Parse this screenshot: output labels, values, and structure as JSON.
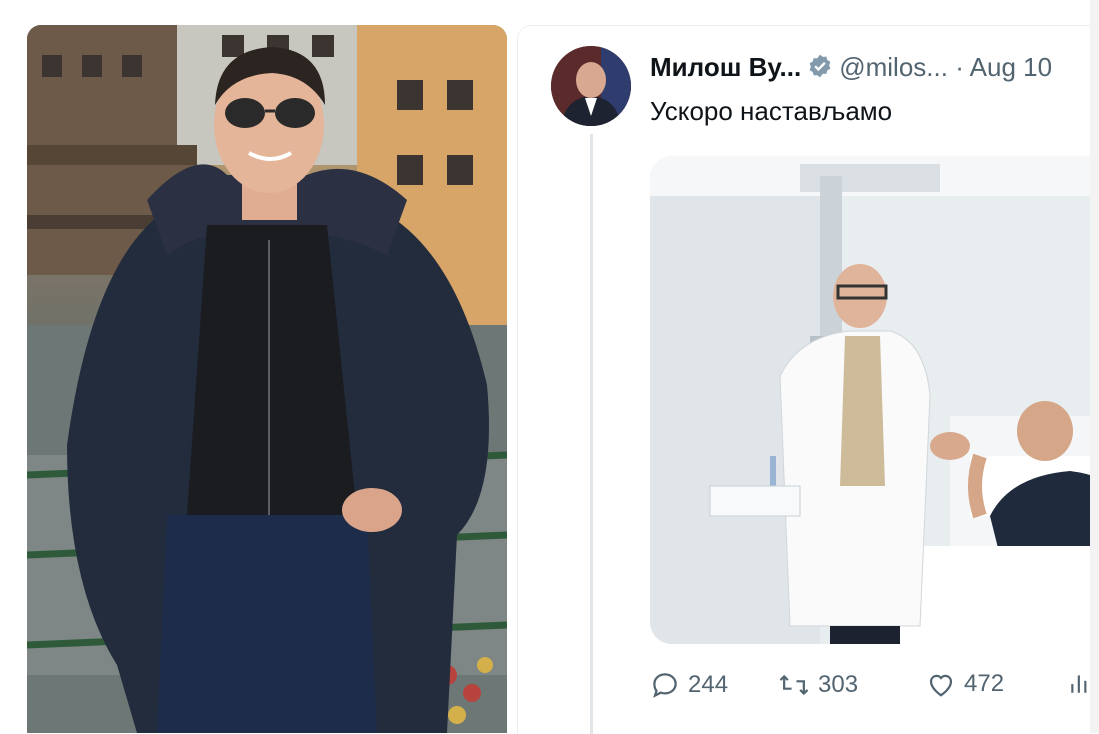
{
  "tweet": {
    "display_name": "Милош Ву...",
    "handle": "@milos...",
    "separator": "·",
    "date": "Aug 10",
    "text": "Ускоро настављамо",
    "counts": {
      "replies": "244",
      "retweets": "303",
      "likes": "472"
    }
  },
  "colors": {
    "verified": "#829aab",
    "text_primary": "#0f1419",
    "text_secondary": "#536471"
  },
  "icons": [
    "verified-badge-icon",
    "reply-icon",
    "retweet-icon",
    "like-icon",
    "views-icon"
  ]
}
